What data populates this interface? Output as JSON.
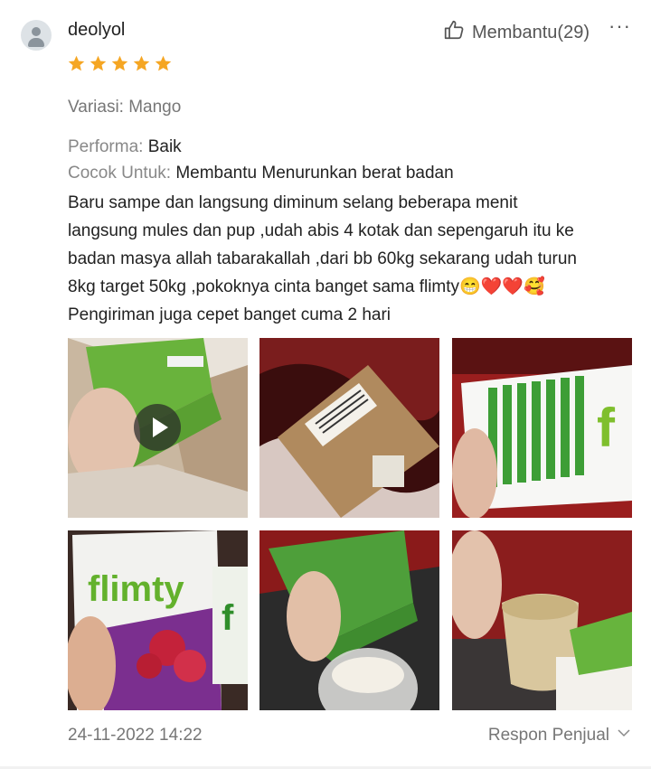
{
  "review": {
    "username": "deolyol",
    "helpful_label": "Membantu(29)",
    "more_label": "···",
    "rating": 5,
    "variation": "Variasi: Mango",
    "performance_key": "Performa: ",
    "performance_value": "Baik",
    "suitable_key": "Cocok Untuk: ",
    "suitable_value": "Membantu Menurunkan berat badan",
    "text": "Baru sampe dan langsung diminum selang beberapa menit\nlangsung mules dan pup ,udah abis 4 kotak dan sepengaruh itu ke\nbadan masya allah tabarakallah ,dari bb 60kg sekarang udah turun\n8kg target 50kg ,pokoknya cinta banget sama flimty😁❤️❤️🥰\nPengiriman juga cepet banget cuma 2 hari",
    "date": "24-11-2022 14:22",
    "seller_response_label": "Respon Penjual"
  },
  "media": [
    {
      "type": "video",
      "name": "video-thumbnail"
    },
    {
      "type": "image",
      "name": "photo-package"
    },
    {
      "type": "image",
      "name": "photo-sachets-box"
    },
    {
      "type": "image",
      "name": "photo-flimty-pack"
    },
    {
      "type": "image",
      "name": "photo-pouring-sachet"
    },
    {
      "type": "image",
      "name": "photo-drink-glass"
    }
  ],
  "colors": {
    "star": "#f5a623",
    "text_muted": "#777777",
    "brand_green": "#4ea53a"
  },
  "icons": {
    "helpful": "thumbs-up-icon",
    "menu": "more-icon",
    "respon": "chevron-down-icon"
  }
}
